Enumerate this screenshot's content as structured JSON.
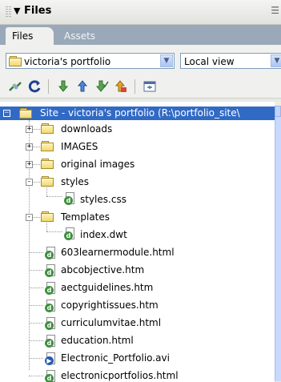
{
  "panel": {
    "title": "Files"
  },
  "tabs": [
    {
      "label": "Files",
      "active": true
    },
    {
      "label": "Assets",
      "active": false
    }
  ],
  "site_select": {
    "value": "victoria's portfolio"
  },
  "view_select": {
    "value": "Local view"
  },
  "toolbar": {
    "buttons": [
      "connect-icon",
      "refresh-icon",
      "get-icon",
      "put-icon",
      "check-out-icon",
      "check-in-icon",
      "expand-icon"
    ]
  },
  "tree": {
    "root": {
      "label": "Site - victoria's portfolio (R:\\portfolio_site\\"
    },
    "items": [
      {
        "label": "downloads",
        "type": "folder",
        "level": 1,
        "expander": "+"
      },
      {
        "label": "IMAGES",
        "type": "folder",
        "level": 1,
        "expander": "+"
      },
      {
        "label": "original images",
        "type": "folder",
        "level": 1,
        "expander": "+"
      },
      {
        "label": "styles",
        "type": "folder",
        "level": 1,
        "expander": "-"
      },
      {
        "label": "styles.css",
        "type": "file",
        "level": 2
      },
      {
        "label": "Templates",
        "type": "folder",
        "level": 1,
        "expander": "-"
      },
      {
        "label": "index.dwt",
        "type": "file",
        "level": 2
      },
      {
        "label": "603learnermodule.html",
        "type": "file",
        "level": 1
      },
      {
        "label": "abcobjective.htm",
        "type": "file",
        "level": 1
      },
      {
        "label": "aectguidelines.htm",
        "type": "file",
        "level": 1
      },
      {
        "label": "copyrightissues.htm",
        "type": "file",
        "level": 1
      },
      {
        "label": "curriculumvitae.html",
        "type": "file",
        "level": 1
      },
      {
        "label": "education.html",
        "type": "file",
        "level": 1
      },
      {
        "label": "Electronic_Portfolio.avi",
        "type": "avi",
        "level": 1
      },
      {
        "label": "electronicportfolios.html",
        "type": "file",
        "level": 1
      }
    ]
  },
  "colors": {
    "selection": "#316ac5",
    "tab_bar": "#9aa9b9",
    "panel_bg": "#f0f1ee"
  }
}
